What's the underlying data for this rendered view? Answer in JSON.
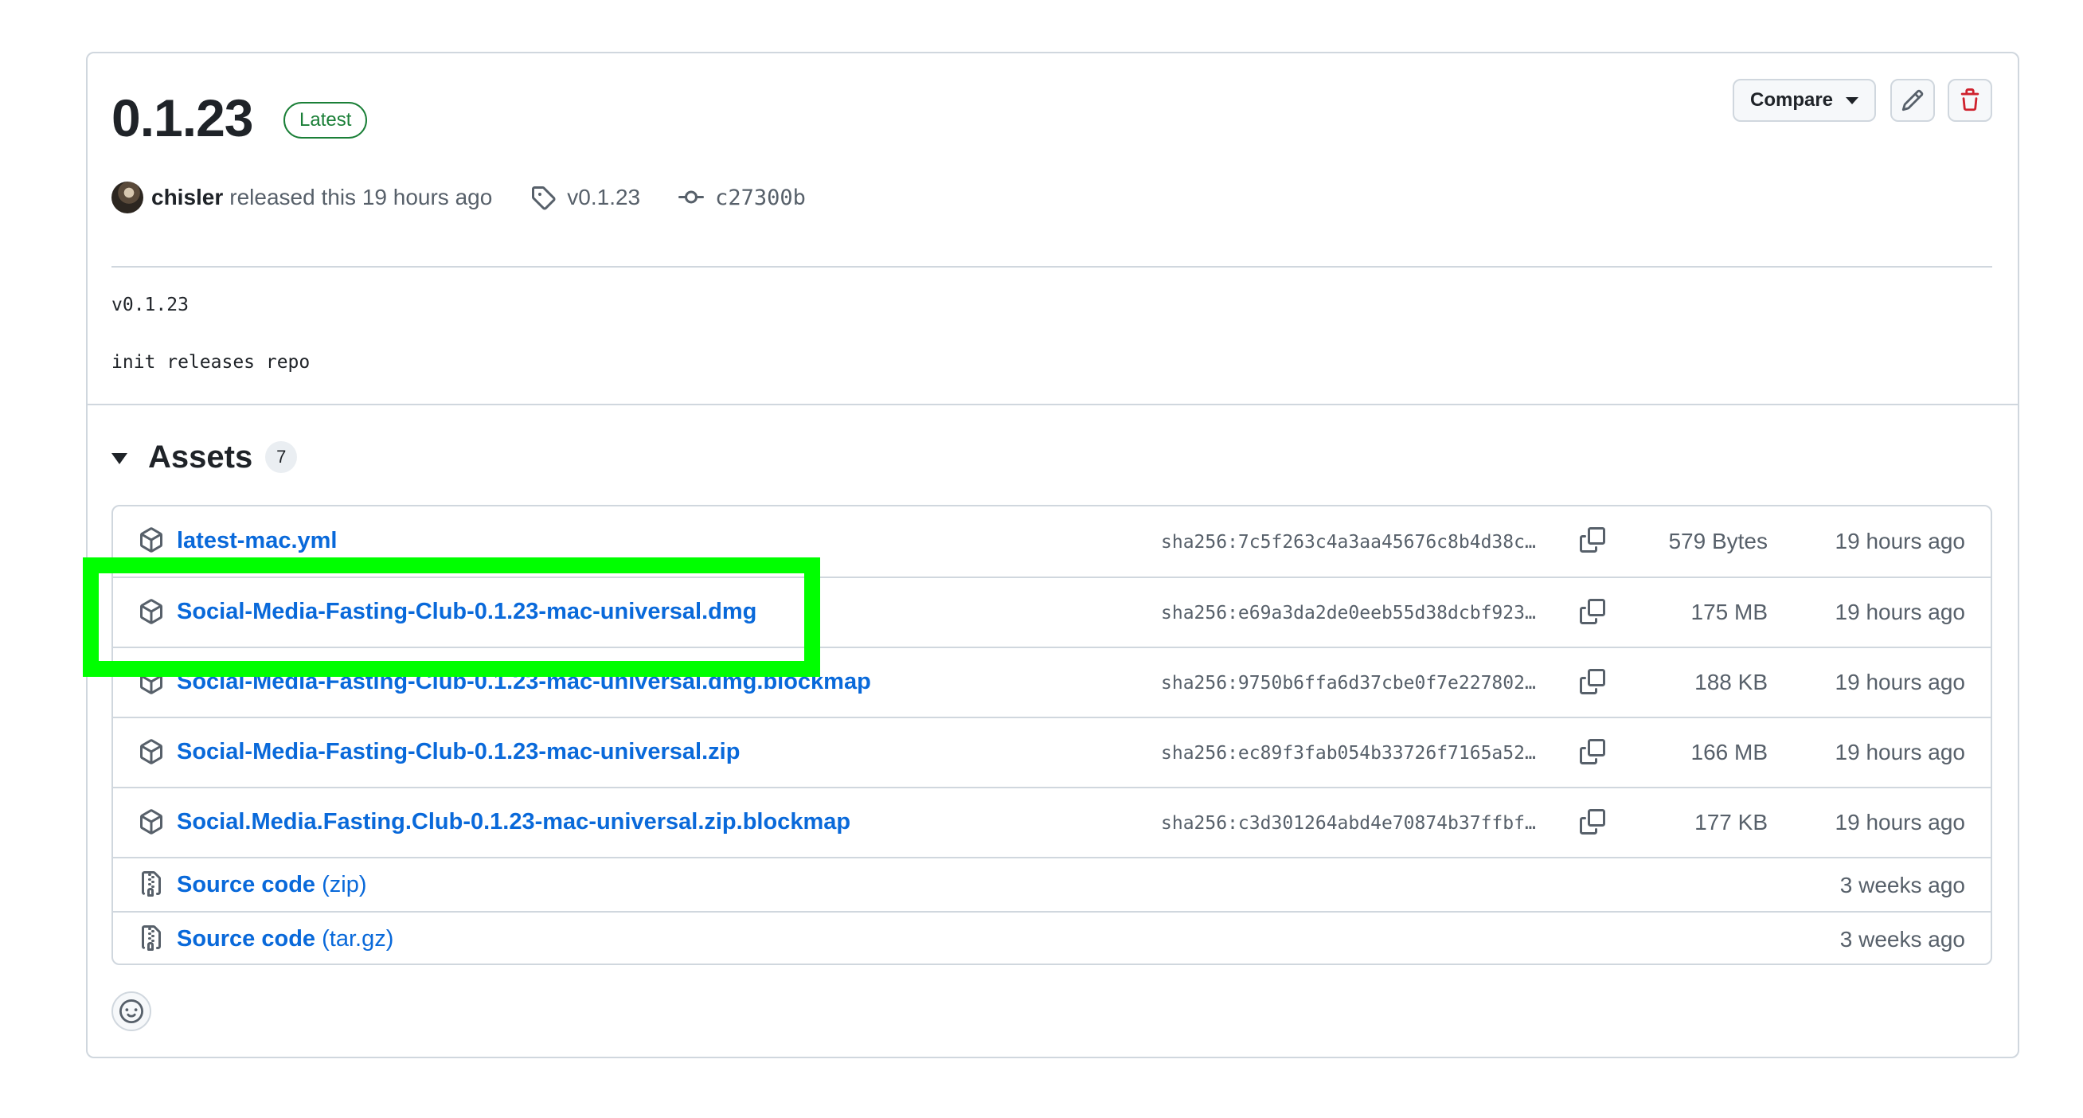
{
  "release": {
    "title": "0.1.23",
    "badge": "Latest",
    "author": "chisler",
    "released_text": "released this 19 hours ago",
    "tag": "v0.1.23",
    "commit": "c27300b",
    "body_line1": "v0.1.23",
    "body_line2": "init releases repo"
  },
  "actions": {
    "compare_label": "Compare",
    "edit_icon": "pencil-icon",
    "delete_icon": "trash-icon"
  },
  "assets": {
    "title": "Assets",
    "count": "7",
    "items": [
      {
        "name": "latest-mac.yml",
        "sha": "sha256:7c5f263c4a3aa45676c8b4d38c…",
        "size": "579 Bytes",
        "date": "19 hours ago"
      },
      {
        "name": "Social-Media-Fasting-Club-0.1.23-mac-universal.dmg",
        "sha": "sha256:e69a3da2de0eeb55d38dcbf923…",
        "size": "175 MB",
        "date": "19 hours ago"
      },
      {
        "name": "Social-Media-Fasting-Club-0.1.23-mac-universal.dmg.blockmap",
        "sha": "sha256:9750b6ffa6d37cbe0f7e227802…",
        "size": "188 KB",
        "date": "19 hours ago"
      },
      {
        "name": "Social-Media-Fasting-Club-0.1.23-mac-universal.zip",
        "sha": "sha256:ec89f3fab054b33726f7165a52…",
        "size": "166 MB",
        "date": "19 hours ago"
      },
      {
        "name": "Social.Media.Fasting.Club-0.1.23-mac-universal.zip.blockmap",
        "sha": "sha256:c3d301264abd4e70874b37ffbf…",
        "size": "177 KB",
        "date": "19 hours ago"
      }
    ],
    "source": [
      {
        "label": "Source code",
        "format": "(zip)",
        "date": "3 weeks ago"
      },
      {
        "label": "Source code",
        "format": "(tar.gz)",
        "date": "3 weeks ago"
      }
    ]
  },
  "colors": {
    "link": "#0969da",
    "latest_badge": "#1a7f37",
    "delete_icon": "#cf222e",
    "highlight": "#00ff00"
  }
}
